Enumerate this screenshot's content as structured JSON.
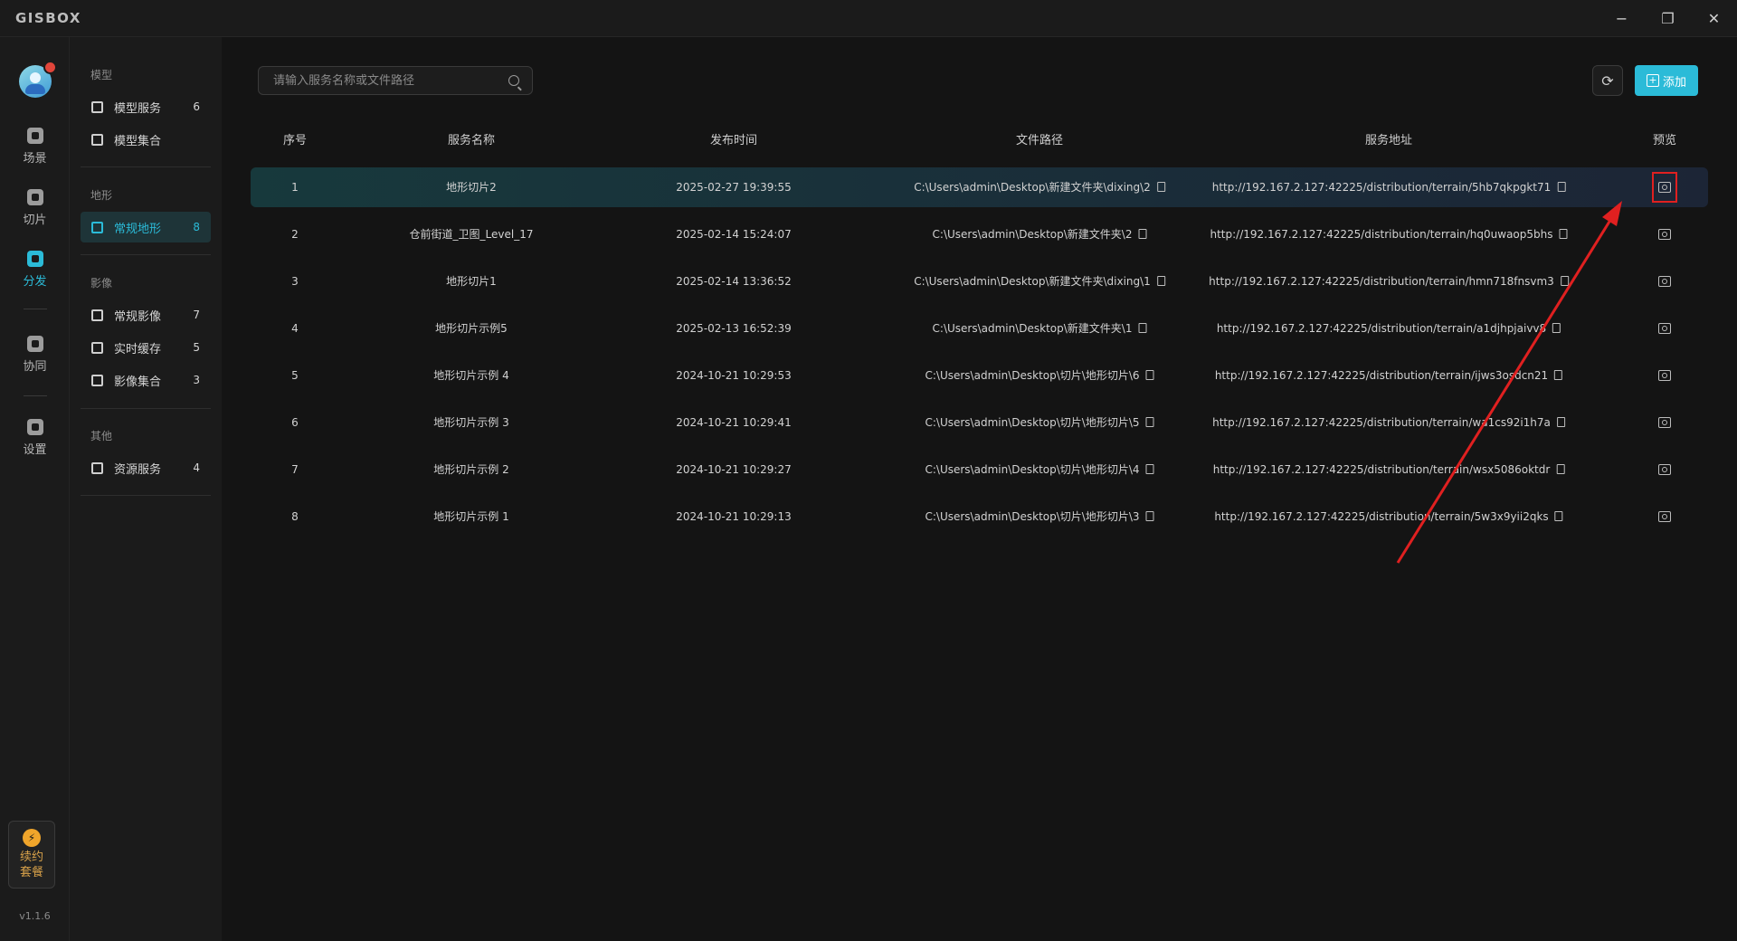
{
  "app": {
    "logo_text": "GISBOX"
  },
  "window_controls": {
    "minimize": "−",
    "maximize": "❐",
    "close": "✕"
  },
  "rail": {
    "items": [
      {
        "label": "场景",
        "icon": "scene-icon"
      },
      {
        "label": "切片",
        "icon": "slice-icon"
      },
      {
        "label": "分发",
        "icon": "distribute-icon",
        "active": true
      },
      {
        "label": "协同",
        "icon": "collaborate-icon"
      },
      {
        "label": "设置",
        "icon": "settings-icon"
      }
    ],
    "renew": {
      "line1": "续约",
      "line2": "套餐",
      "icon": "bolt-icon"
    },
    "version": "v1.1.6"
  },
  "subnav": {
    "sections": [
      {
        "title": "模型",
        "items": [
          {
            "label": "模型服务",
            "count": "6"
          },
          {
            "label": "模型集合",
            "count": ""
          }
        ]
      },
      {
        "title": "地形",
        "items": [
          {
            "label": "常规地形",
            "count": "8",
            "active": true
          }
        ]
      },
      {
        "title": "影像",
        "items": [
          {
            "label": "常规影像",
            "count": "7"
          },
          {
            "label": "实时缓存",
            "count": "5"
          },
          {
            "label": "影像集合",
            "count": "3"
          }
        ]
      },
      {
        "title": "其他",
        "items": [
          {
            "label": "资源服务",
            "count": "4"
          }
        ]
      }
    ]
  },
  "toolbar": {
    "search_placeholder": "请输入服务名称或文件路径",
    "refresh_icon": "refresh-icon",
    "add_label": "添加"
  },
  "table": {
    "headers": {
      "index": "序号",
      "name": "服务名称",
      "time": "发布时间",
      "path": "文件路径",
      "url": "服务地址",
      "preview": "预览"
    },
    "rows": [
      {
        "index": "1",
        "name": "地形切片2",
        "time": "2025-02-27 19:39:55",
        "path": "C:\\Users\\admin\\Desktop\\新建文件夹\\dixing\\2",
        "url": "http://192.167.2.127:42225/distribution/terrain/5hb7qkpgkt71",
        "selected": true
      },
      {
        "index": "2",
        "name": "仓前街道_卫图_Level_17",
        "time": "2025-02-14 15:24:07",
        "path": "C:\\Users\\admin\\Desktop\\新建文件夹\\2",
        "url": "http://192.167.2.127:42225/distribution/terrain/hq0uwaop5bhs"
      },
      {
        "index": "3",
        "name": "地形切片1",
        "time": "2025-02-14 13:36:52",
        "path": "C:\\Users\\admin\\Desktop\\新建文件夹\\dixing\\1",
        "url": "http://192.167.2.127:42225/distribution/terrain/hmn718fnsvm3"
      },
      {
        "index": "4",
        "name": "地形切片示例5",
        "time": "2025-02-13 16:52:39",
        "path": "C:\\Users\\admin\\Desktop\\新建文件夹\\1",
        "url": "http://192.167.2.127:42225/distribution/terrain/a1djhpjaivv8"
      },
      {
        "index": "5",
        "name": "地形切片示例 4",
        "time": "2024-10-21 10:29:53",
        "path": "C:\\Users\\admin\\Desktop\\切片\\地形切片\\6",
        "url": "http://192.167.2.127:42225/distribution/terrain/ijws3osdcn21"
      },
      {
        "index": "6",
        "name": "地形切片示例 3",
        "time": "2024-10-21 10:29:41",
        "path": "C:\\Users\\admin\\Desktop\\切片\\地形切片\\5",
        "url": "http://192.167.2.127:42225/distribution/terrain/wa1cs92i1h7a"
      },
      {
        "index": "7",
        "name": "地形切片示例 2",
        "time": "2024-10-21 10:29:27",
        "path": "C:\\Users\\admin\\Desktop\\切片\\地形切片\\4",
        "url": "http://192.167.2.127:42225/distribution/terrain/wsx5086oktdr"
      },
      {
        "index": "8",
        "name": "地形切片示例 1",
        "time": "2024-10-21 10:29:13",
        "path": "C:\\Users\\admin\\Desktop\\切片\\地形切片\\3",
        "url": "http://192.167.2.127:42225/distribution/terrain/5w3x9yii2qks"
      }
    ]
  },
  "colors": {
    "accent": "#2bbbd8",
    "annotation": "#e02020",
    "background": "#141414"
  }
}
